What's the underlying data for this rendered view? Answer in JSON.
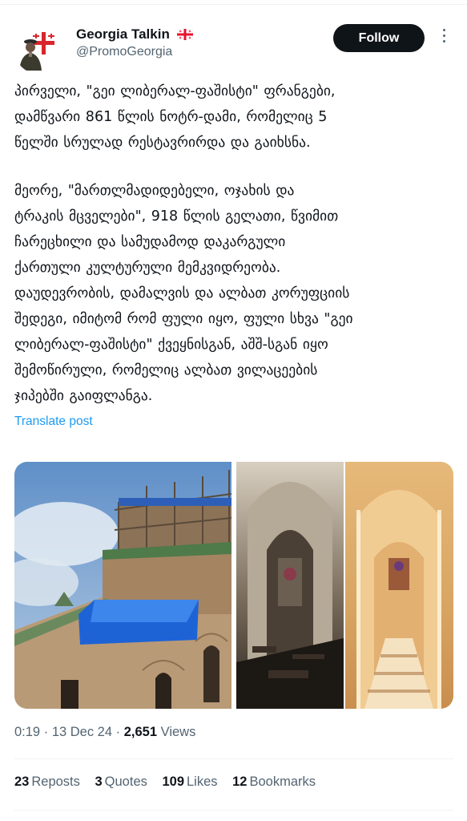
{
  "author": {
    "display_name": "Georgia Talkin",
    "handle": "@PromoGeorgia"
  },
  "follow_label": "Follow",
  "tweet": {
    "paragraph1": [
      "პირველი, \"გეი ლიბერალ-ფაშისტი\" ფრანგები,",
      "დამწვარი 861 წლის ნოტრ-დამი, რომელიც 5",
      "წელში სრულად რესტავრირდა და გაიხსნა."
    ],
    "paragraph2": [
      "მეორე, \"მართლმადიდებელი, ოჯახის და",
      "ტრაკის მცველები\", 918 წლის გელათი, წვიმით",
      "ჩარეცხილი და სამუდამოდ დაკარგული",
      "ქართული კულტურული მემკვიდრეობა.",
      "დაუდევრობის, დამალვის და ალბათ კორუფციის",
      "შედეგი, იმიტომ რომ ფული იყო, ფული სხვა \"გეი",
      "ლიბერალ-ფაშისტი\" ქვეყნისგან, აშშ-სგან იყო",
      "შემოწირული, რომელიც ალბათ ვილაცეების",
      "ჯიპებში გაიფლანგა."
    ]
  },
  "translate_label": "Translate post",
  "meta": {
    "time": "0:19",
    "separator": "·",
    "date": "13 Dec 24",
    "views_count": "2,651",
    "views_label": "Views"
  },
  "stats": [
    {
      "count": "23",
      "label": "Reposts"
    },
    {
      "count": "3",
      "label": "Quotes"
    },
    {
      "count": "109",
      "label": "Likes"
    },
    {
      "count": "12",
      "label": "Bookmarks"
    }
  ],
  "colors": {
    "accent": "#1d9bf0",
    "follow_bg": "#0f1419",
    "secondary_text": "#536471"
  },
  "icons": [
    "georgian-flag-icon",
    "more-options-icon"
  ]
}
